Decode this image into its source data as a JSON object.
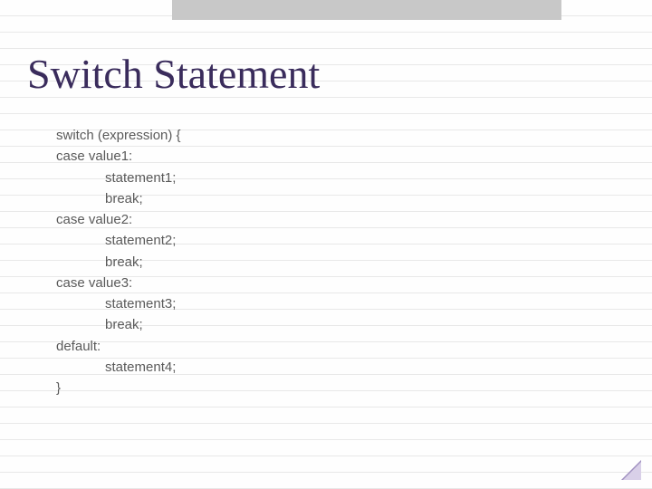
{
  "slide": {
    "title": "Switch Statement",
    "code": {
      "l01": "switch (expression) {",
      "l02": "case value1:",
      "l03": "statement1;",
      "l04": "break;",
      "l05": "case value2:",
      "l06": "statement2;",
      "l07": "break;",
      "l08": "case value3:",
      "l09": "statement3;",
      "l10": "break;",
      "l11": "default:",
      "l12": "statement4;",
      "l13": "}"
    }
  }
}
